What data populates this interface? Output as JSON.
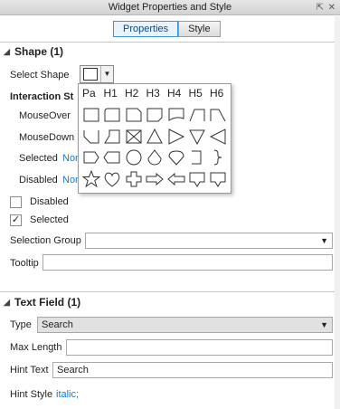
{
  "window": {
    "title": "Widget Properties and Style",
    "pin_glyph": "⇱",
    "close_glyph": "✕"
  },
  "tabs": [
    {
      "label": "Properties"
    },
    {
      "label": "Style"
    }
  ],
  "shape_section": {
    "title": "Shape (1)",
    "select_shape_label": "Select Shape",
    "interaction_styles_label": "Interaction St",
    "mouseover_label": "MouseOver",
    "mousedown_label": "MouseDown",
    "selected_label": "Selected",
    "selected_value": "Non",
    "disabled_label": "Disabled",
    "disabled_value": "Non",
    "disabled_checkbox_label": "Disabled",
    "selected_checkbox_label": "Selected",
    "selected_checkbox_mark": "✓",
    "selection_group_label": "Selection Group",
    "selection_group_value": "",
    "tooltip_label": "Tooltip",
    "tooltip_value": ""
  },
  "shape_picker": {
    "headings": [
      "Pa",
      "H1",
      "H2",
      "H3",
      "H4",
      "H5",
      "H6"
    ],
    "rows": [
      [
        "rectangle-shape",
        "rounded-rect-shape",
        "rect-tab-shape",
        "rect-corner-shape",
        "rect-wave-shape",
        "trapezoid-right-shape",
        "trapezoid-shape"
      ],
      [
        "notched-bottom-shape",
        "parallelogram-shape",
        "placeholder-shape",
        "triangle-up-shape",
        "triangle-right-shape",
        "triangle-down-shape",
        "triangle-left-shape"
      ],
      [
        "pentagon-shape",
        "hexagon-shape",
        "ellipse-shape",
        "teardrop-shape",
        "heart-rounded-shape",
        "bracket-shape",
        "brace-shape"
      ],
      [
        "star-shape",
        "heart-shape",
        "cross-shape",
        "arrow-right-shape",
        "arrow-left-shape",
        "callout-shape",
        "callout-down-shape"
      ]
    ]
  },
  "text_field_section": {
    "title": "Text Field (1)",
    "type_label": "Type",
    "type_value": "Search",
    "max_length_label": "Max Length",
    "max_length_value": "",
    "hint_text_label": "Hint Text",
    "hint_text_value": "Search",
    "hint_style_label": "Hint Style",
    "hint_style_value": "italic;"
  },
  "icons": {
    "section_collapse": "◢",
    "dropdown": "▼"
  }
}
